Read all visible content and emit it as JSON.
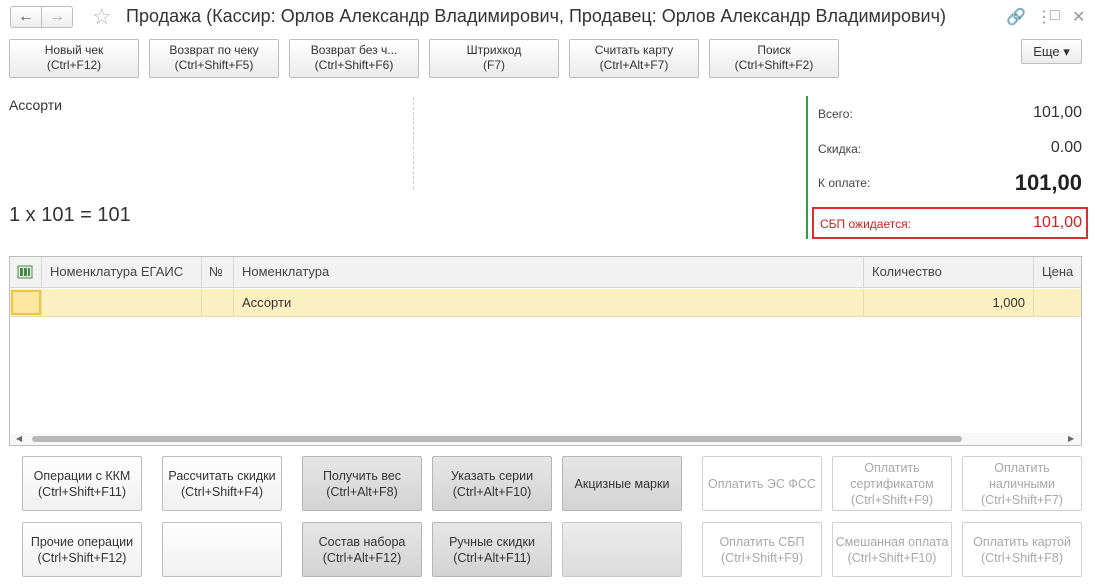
{
  "window": {
    "title": "Продажа (Кассир: Орлов Александр Владимирович, Продавец: Орлов Александр Владимирович)",
    "back_icon": "←",
    "forward_icon": "→",
    "star_icon": "☆",
    "link_icon": "🔗",
    "menu_icon": "⋮",
    "maximize_icon": "□",
    "close_icon": "✕"
  },
  "toolbar": {
    "buttons": [
      {
        "line1": "Новый чек",
        "line2": "(Ctrl+F12)"
      },
      {
        "line1": "Возврат по чеку",
        "line2": "(Ctrl+Shift+F5)"
      },
      {
        "line1": "Возврат без ч...",
        "line2": "(Ctrl+Shift+F6)"
      },
      {
        "line1": "Штрихкод",
        "line2": "(F7)"
      },
      {
        "line1": "Считать карту",
        "line2": "(Ctrl+Alt+F7)"
      },
      {
        "line1": "Поиск",
        "line2": "(Ctrl+Shift+F2)"
      }
    ],
    "more_label": "Еще ▾"
  },
  "info": {
    "product_name": "Ассорти",
    "formula": "1 x 101 = 101"
  },
  "summary": {
    "total_label": "Всего:",
    "total_value": "101,00",
    "discount_label": "Скидка:",
    "discount_value": "0.00",
    "to_pay_label": "К оплате:",
    "to_pay_value": "101,00",
    "sbp_label": "СБП ожидается:",
    "sbp_value": "101,00",
    "accent_color": "#2e9e3f",
    "alert_color": "#d01e1e"
  },
  "table": {
    "columns": [
      "",
      "Номенклатура ЕГАИС",
      "№",
      "Номенклатура",
      "Количество",
      "Цена"
    ],
    "rows": [
      {
        "egais": "",
        "num": "",
        "name": "Ассорти",
        "qty": "1,000",
        "price": ""
      }
    ]
  },
  "actions": {
    "row1": [
      {
        "text": "Операции с ККМ (Ctrl+Shift+F11)"
      },
      {
        "text": "Рассчитать скидки (Ctrl+Shift+F4)"
      },
      {
        "text": "Получить вес (Ctrl+Alt+F8)"
      },
      {
        "text": "Указать серии (Ctrl+Alt+F10)"
      },
      {
        "text": "Акцизные марки"
      },
      {
        "text": "Оплатить ЭС ФСС"
      },
      {
        "text": "Оплатить сертификатом (Ctrl+Shift+F9)"
      },
      {
        "text": "Оплатить наличными (Ctrl+Shift+F7)"
      }
    ],
    "row2": [
      {
        "text": "Прочие операции (Ctrl+Shift+F12)"
      },
      {
        "text": ""
      },
      {
        "text": "Состав набора (Ctrl+Alt+F12)"
      },
      {
        "text": "Ручные скидки (Ctrl+Alt+F11)"
      },
      {
        "text": ""
      },
      {
        "text": "Оплатить СБП (Ctrl+Shift+F9)"
      },
      {
        "text": "Смешанная оплата (Ctrl+Shift+F10)"
      },
      {
        "text": "Оплатить картой (Ctrl+Shift+F8)"
      }
    ]
  }
}
